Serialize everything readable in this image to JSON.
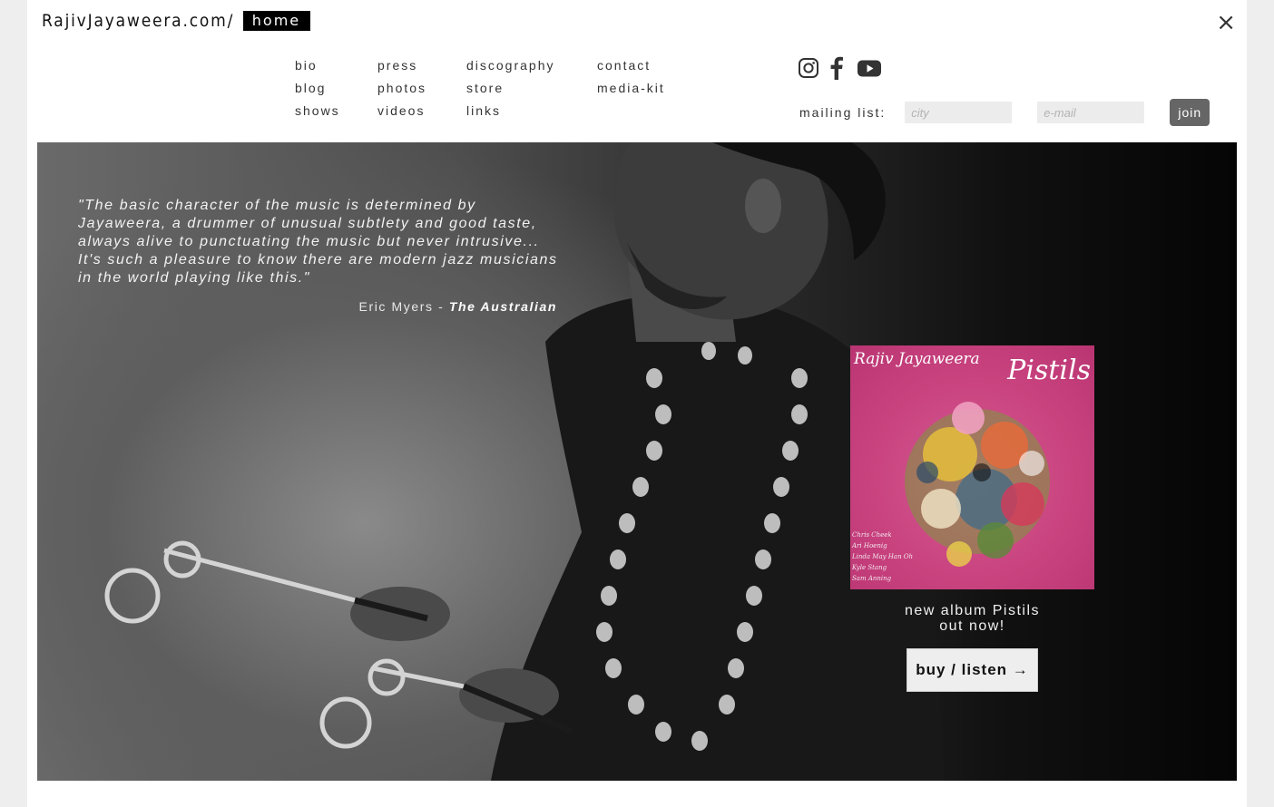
{
  "header": {
    "site_name": "RajivJayaweera.com/",
    "current_page": "home",
    "close_label": "×"
  },
  "nav": {
    "columns": [
      [
        "bio",
        "blog",
        "shows"
      ],
      [
        "press",
        "photos",
        "videos"
      ],
      [
        "discography",
        "store",
        "links"
      ],
      [
        "contact",
        "media-kit"
      ]
    ]
  },
  "social": {
    "icons": [
      "instagram-icon",
      "facebook-icon",
      "youtube-icon"
    ]
  },
  "mailing_list": {
    "label": "mailing list:",
    "city_placeholder": "city",
    "email_placeholder": "e-mail",
    "city_value": "",
    "email_value": "",
    "join_label": "join",
    "join_color": "#666666"
  },
  "hero": {
    "quote": "\"The basic character of the music is determined by Jayaweera, a drummer of unusual subtlety and good taste, always alive to punctuating the music but never intrusive... It's such a pleasure to know there are modern jazz musicians in the world playing like this.\"",
    "attribution_author": "Eric Myers - ",
    "attribution_publication": "The Australian"
  },
  "album": {
    "cover_artist": "Rajiv Jayaweera",
    "cover_title": "Pistils",
    "cover_names": [
      "Chris Cheek",
      "Ari Hoenig",
      "Linda May Han Oh",
      "Kyle Stang",
      "Sam Anning"
    ],
    "caption_line1": "new album Pistils",
    "caption_line2": "out now!",
    "button_label": "buy / listen →",
    "cover_color": "#c9437f"
  }
}
